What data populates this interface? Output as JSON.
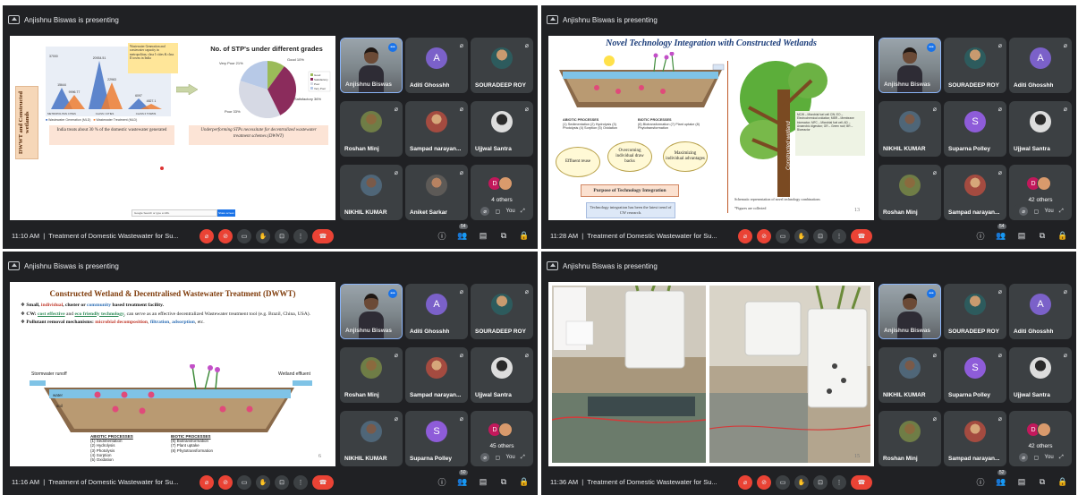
{
  "presenter_text": "Anjishnu Biswas is presenting",
  "meeting_title": "Treatment of Domestic Wastewater for Su...",
  "you_label": "You",
  "quadrants": [
    {
      "time": "11:10 AM",
      "people_badge": "54",
      "tiles": [
        {
          "name": "Anjishnu Biswas",
          "type": "self"
        },
        {
          "name": "Aditi Ghosshh",
          "type": "letter",
          "letter": "A",
          "color": "#7b61c9"
        },
        {
          "name": "SOURADEEP ROY",
          "type": "photo",
          "style": "photo-av"
        },
        {
          "name": "Roshan Minj",
          "type": "photo",
          "style": "photo-av4"
        },
        {
          "name": "Sampad narayan...",
          "type": "photo",
          "style": "photo-av5"
        },
        {
          "name": "Ujjwal Santra",
          "type": "photo",
          "style": "photo-av3"
        },
        {
          "name": "NIKHIL KUMAR",
          "type": "photo",
          "style": "photo-av6"
        },
        {
          "name": "Aniket Sarkar",
          "type": "photo",
          "style": "photo-av2"
        },
        {
          "name": "4 others",
          "type": "others",
          "letter": "D"
        }
      ]
    },
    {
      "time": "11:28 AM",
      "people_badge": "54",
      "tiles": [
        {
          "name": "Anjishnu Biswas",
          "type": "self"
        },
        {
          "name": "SOURADEEP ROY",
          "type": "photo",
          "style": "photo-av"
        },
        {
          "name": "Aditi Ghosshh",
          "type": "letter",
          "letter": "A",
          "color": "#7b61c9"
        },
        {
          "name": "NIKHIL KUMAR",
          "type": "photo",
          "style": "photo-av6"
        },
        {
          "name": "Suparna Polley",
          "type": "letter",
          "letter": "S",
          "color": "#8e5cd9"
        },
        {
          "name": "Ujjwal Santra",
          "type": "photo",
          "style": "photo-av3"
        },
        {
          "name": "Roshan Minj",
          "type": "photo",
          "style": "photo-av4"
        },
        {
          "name": "Sampad narayan...",
          "type": "photo",
          "style": "photo-av5"
        },
        {
          "name": "42 others",
          "type": "others",
          "letter": "D"
        }
      ]
    },
    {
      "time": "11:16 AM",
      "people_badge": "50",
      "tiles": [
        {
          "name": "Anjishnu Biswas",
          "type": "self"
        },
        {
          "name": "Aditi Ghosshh",
          "type": "letter",
          "letter": "A",
          "color": "#7b61c9"
        },
        {
          "name": "SOURADEEP ROY",
          "type": "photo",
          "style": "photo-av"
        },
        {
          "name": "Roshan Minj",
          "type": "photo",
          "style": "photo-av4"
        },
        {
          "name": "Sampad narayan...",
          "type": "photo",
          "style": "photo-av5"
        },
        {
          "name": "Ujjwal Santra",
          "type": "photo",
          "style": "photo-av3"
        },
        {
          "name": "NIKHIL KUMAR",
          "type": "photo",
          "style": "photo-av6"
        },
        {
          "name": "Suparna Polley",
          "type": "letter",
          "letter": "S",
          "color": "#8e5cd9"
        },
        {
          "name": "45 others",
          "type": "others",
          "letter": "D"
        }
      ]
    },
    {
      "time": "11:36 AM",
      "people_badge": "52",
      "tiles": [
        {
          "name": "Anjishnu Biswas",
          "type": "self"
        },
        {
          "name": "SOURADEEP ROY",
          "type": "photo",
          "style": "photo-av"
        },
        {
          "name": "Aditi Ghosshh",
          "type": "letter",
          "letter": "A",
          "color": "#7b61c9"
        },
        {
          "name": "NIKHIL KUMAR",
          "type": "photo",
          "style": "photo-av6"
        },
        {
          "name": "Suparna Polley",
          "type": "letter",
          "letter": "S",
          "color": "#8e5cd9"
        },
        {
          "name": "Ujjwal Santra",
          "type": "photo",
          "style": "photo-av3"
        },
        {
          "name": "Roshan Minj",
          "type": "photo",
          "style": "photo-av4"
        },
        {
          "name": "Sampad narayan...",
          "type": "photo",
          "style": "photo-av5"
        },
        {
          "name": "42 others",
          "type": "others",
          "letter": "D"
        }
      ]
    }
  ],
  "slide0": {
    "side_label": "DWWT and Constructed wetlands",
    "bar_values": [
      "37000",
      "22963",
      "20934.51",
      "15644",
      "6097",
      "9996.77",
      "4827.1"
    ],
    "bar_categories": [
      "METROPOLITAN CITIES",
      "CLASS I CITIES",
      "CLASS II TOWNS"
    ],
    "yellow_box": "Wastewater Generation and wastewater capacity in metropolitan, class I cities & class II towns in India",
    "legend": [
      "Wastewater Generation (MLD)",
      "Wastewater Treatment (MLD)"
    ],
    "pie_title": "No. of STP's under different grades",
    "pie_labels": {
      "very_poor": "Very Poor 21%",
      "good": "Good 10%",
      "satisfactory": "Satisfactory 36%",
      "poor": "Poor 33%"
    },
    "pie_legend": [
      "Good",
      "Satisfactory",
      "Poor",
      "Very Poor"
    ],
    "caption_left": "India treats about 30 % of the domestic wastewater generated",
    "caption_right": "Underperforming STPs necessitate for decentralized wastewater treatment schemes (DWWT)",
    "search_text": "Google Search or type a URL",
    "search_btn": "Share screen"
  },
  "slide1": {
    "title": "Novel Technology Integration with Constructed Wetlands",
    "abiotic_title": "ABIOTIC PROCESSES",
    "abiotic_items": "(1) Sedimentation (2) Hydrolysis (3) Photolysis (4) Sorption (5) Oxidation",
    "biotic_title": "BIOTIC PROCESSES",
    "biotic_items": "(6) Biotransformation (7) Plant uptake (8) Phytotransformation",
    "circle1": "Effluent reuse",
    "circle2": "Overcoming individual draw backs",
    "circle3": "Maximizing individual advantages",
    "purpose": "Purpose of Technology Integration",
    "latest": "Technology integration has been the latest trend of CW research.",
    "tree_label": "Constructed wetland",
    "legend_box": "MCW – Microbial fuel cell CW; EO – Electrochemical oxidation; MBR – Membrane bioreactor; MFC – Microbial fuel cell; AD – Anaerobic digestion; GR – Green roof; BR – Bioreactor",
    "schema": "Schematic representation of novel technology combinations",
    "figs": "*Figures are collected",
    "slide_num": "13"
  },
  "slide2": {
    "title": "Constructed Wetland & Decentralised Wastewater Treatment (DWWT)",
    "b1_pre": "Small, ",
    "b1_red": "individual",
    "b1_mid": ", cluster or ",
    "b1_blue": "community",
    "b1_post": " based treatment facility.",
    "b2_pre": "CW: ",
    "b2_g1": "cost effective",
    "b2_and": " and ",
    "b2_g2": "eco friendly technology",
    "b2_post": ", can serve as an effective decentralized Wastewater treatment tool (e.g. Brazil, China, USA).",
    "b3_pre": "Pollutant removal mechanisms: ",
    "b3_r": "microbial decomposition",
    "b3_mid": ", ",
    "b3_b1": "filtration",
    "b3_and": ", ",
    "b3_b2": "adsorption",
    "b3_post": ", etc.",
    "stormwater": "Stormwater runoff",
    "wetland": "Wetland effluent",
    "water": "water",
    "soil": "soil",
    "abiotic_title": "ABIOTIC PROCESSES",
    "abiotic_items": [
      "(1) Sedimentation",
      "(2) Hydrolysis",
      "(3) Photolysis",
      "(4) Sorption",
      "(5) Oxidation"
    ],
    "biotic_title": "BIOTIC PROCESSES",
    "biotic_items": [
      "(6) Biotransformation",
      "(7) Plant uptake",
      "(8) Phytotransformation"
    ],
    "slide_num": "6"
  },
  "slide3": {
    "slide_num": "15"
  }
}
